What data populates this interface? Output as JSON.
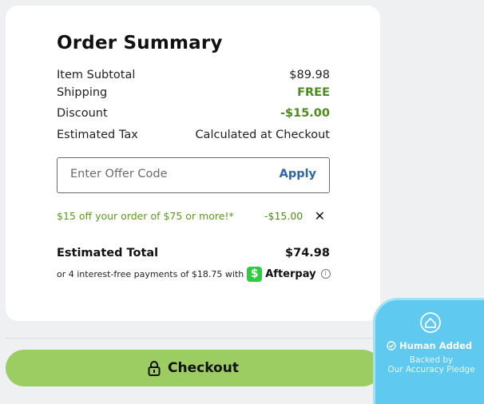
{
  "summary": {
    "title": "Order Summary",
    "rows": [
      {
        "label": "Item Subtotal",
        "value": "$89.98"
      },
      {
        "label": "Shipping",
        "value": "FREE"
      },
      {
        "label": "Discount",
        "value": "-$15.00"
      },
      {
        "label": "Estimated Tax",
        "value": "Calculated at Checkout"
      }
    ],
    "offer": {
      "placeholder": "Enter Offer Code",
      "apply_label": "Apply"
    },
    "promo": {
      "description": "$15 off your order of $75 or more!*",
      "amount": "-$15.00",
      "remove": "✕"
    },
    "total": {
      "label": "Estimated Total",
      "value": "$74.98"
    },
    "afterpay": {
      "text": "or 4 interest-free payments of $18.75 with",
      "logo_char": "$",
      "brand": "Afterpay",
      "info": "i"
    }
  },
  "checkout": {
    "label": "Checkout"
  },
  "badge": {
    "title": "Human Added",
    "subtitle_line1": "Backed by",
    "subtitle_line2": "Our Accuracy Pledge"
  },
  "colors": {
    "accent_green": "#9ccd62",
    "discount_green": "#4a8c1c",
    "link_blue": "#2e67a6",
    "badge_blue": "#5fc9ef"
  }
}
